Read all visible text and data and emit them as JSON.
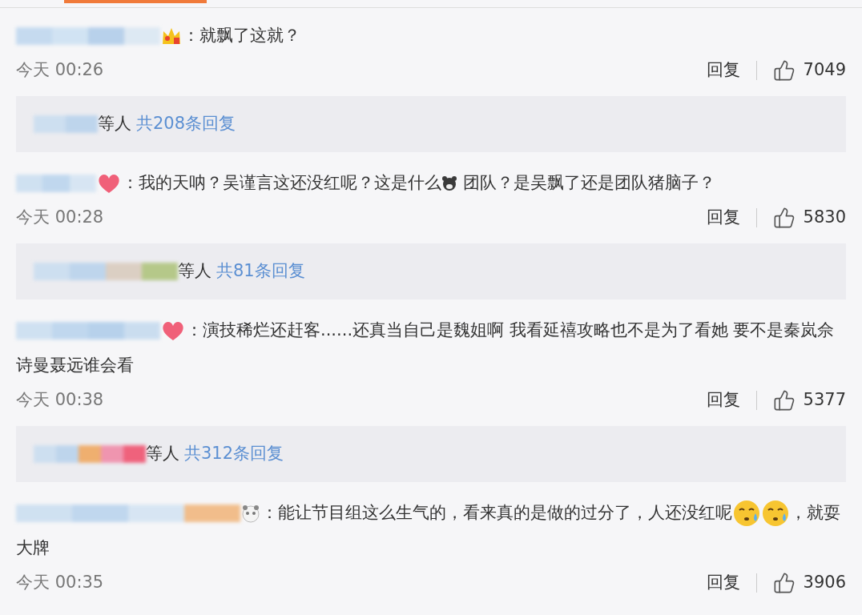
{
  "comments": [
    {
      "badge": {
        "kind": "crown"
      },
      "segments": [
        {
          "kind": "text",
          "text": "：就飘了这就？"
        }
      ],
      "time": "今天 00:26",
      "reply": "回复",
      "likes": "7049",
      "summary": {
        "suffix": "等人",
        "link": "共208条回复"
      }
    },
    {
      "badge": {
        "kind": "heart"
      },
      "segments": [
        {
          "kind": "text",
          "text": "：我的天呐？吴谨言这还没红呢？这是什么"
        },
        {
          "kind": "bear"
        },
        {
          "kind": "text",
          "text": " 团队？是吴飘了还是团队猪脑子？"
        }
      ],
      "time": "今天 00:28",
      "reply": "回复",
      "likes": "5830",
      "summary": {
        "suffix": "等人",
        "link": "共81条回复"
      }
    },
    {
      "badge": {
        "kind": "heart"
      },
      "segments": [
        {
          "kind": "text",
          "text": "：演技稀烂还赶客......还真当自己是魏姐啊 我看延禧攻略也不是为了看她 要不是秦岚佘诗曼聂远谁会看"
        }
      ],
      "time": "今天 00:38",
      "reply": "回复",
      "likes": "5377",
      "summary": {
        "suffix": "等人",
        "link": "共312条回复"
      }
    },
    {
      "badge": {
        "kind": "panda"
      },
      "segments": [
        {
          "kind": "text",
          "text": "：能让节目组这么生气的，看来真的是做的过分了，人还没红呢"
        },
        {
          "kind": "sweat"
        },
        {
          "kind": "sweat"
        },
        {
          "kind": "text",
          "text": "，就耍大牌"
        }
      ],
      "time": "今天 00:35",
      "reply": "回复",
      "likes": "3906"
    }
  ]
}
